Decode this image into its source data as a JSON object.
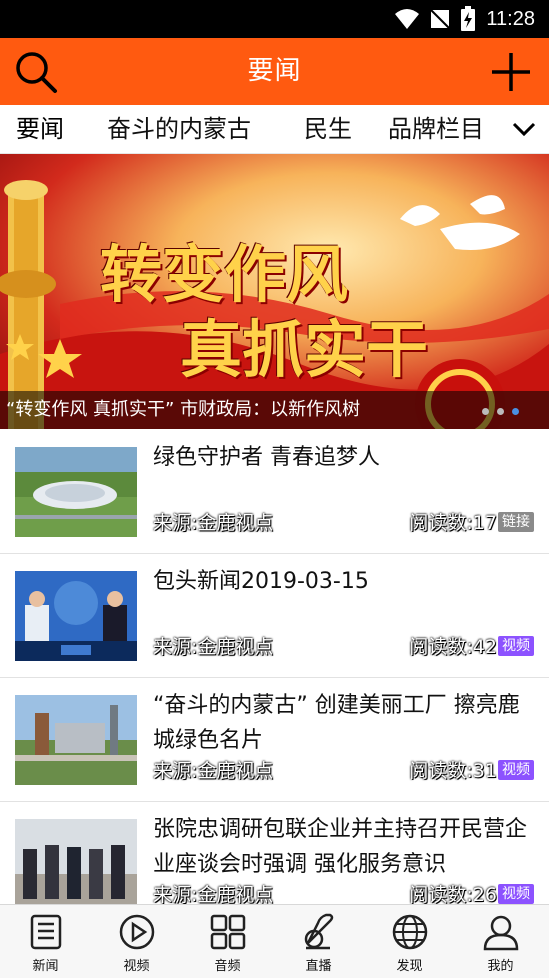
{
  "status_bar": {
    "time": "11:28"
  },
  "header": {
    "title": "要闻"
  },
  "tabs": [
    {
      "label": "要闻"
    },
    {
      "label": "奋斗的内蒙古"
    },
    {
      "label": "民生"
    },
    {
      "label": "品牌栏目"
    }
  ],
  "banner": {
    "caption": "“转变作风 真抓实干” 市财政局：以新作风树",
    "line1": "转变作风",
    "line2": "真抓实干",
    "dots": 3,
    "active_dot": 3
  },
  "news": [
    {
      "title": "绿色守护者 青春追梦人",
      "source": "来源:金鹿视点",
      "reads": "阅读数:17",
      "badge": "链接",
      "badge_type": "link"
    },
    {
      "title": "包头新闻2019-03-15",
      "source": "来源:金鹿视点",
      "reads": "阅读数:42",
      "badge": "视频",
      "badge_type": "video"
    },
    {
      "title": "“奋斗的内蒙古” 创建美丽工厂 擦亮鹿城绿色名片",
      "source": "来源:金鹿视点",
      "reads": "阅读数:31",
      "badge": "视频",
      "badge_type": "video"
    },
    {
      "title": "张院忠调研包联企业并主持召开民营企业座谈会时强调 强化服务意识",
      "source": "来源:金鹿视点",
      "reads": "阅读数:26",
      "badge": "视频",
      "badge_type": "video"
    }
  ],
  "bottom_nav": [
    {
      "label": "新闻",
      "icon": "news-icon"
    },
    {
      "label": "视频",
      "icon": "video-icon"
    },
    {
      "label": "音频",
      "icon": "audio-icon"
    },
    {
      "label": "直播",
      "icon": "live-icon"
    },
    {
      "label": "发现",
      "icon": "discover-icon"
    },
    {
      "label": "我的",
      "icon": "profile-icon"
    }
  ],
  "colors": {
    "header": "#ff5a10",
    "link_badge": "#8a8a8a",
    "video_badge": "#8c52ff",
    "dot_active": "#4a90e2"
  }
}
